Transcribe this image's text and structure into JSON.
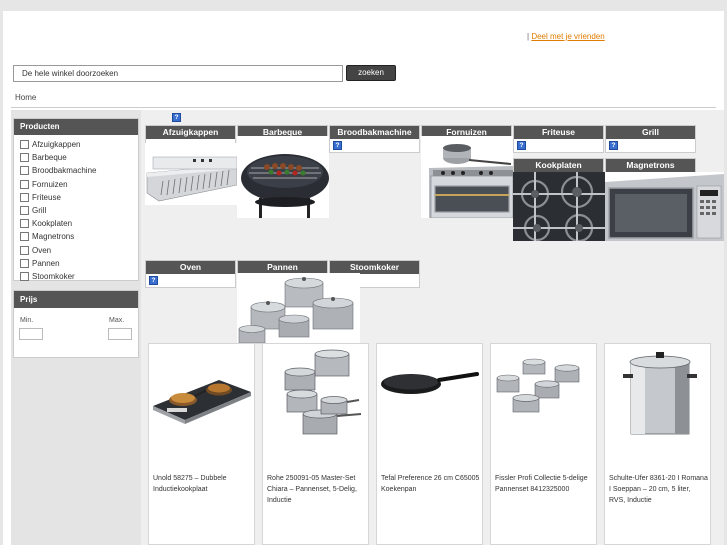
{
  "header": {
    "separator": "|",
    "share_link": "Deel met je vrienden"
  },
  "search": {
    "value": "De hele winkel doorzoeken",
    "button": "zoeken"
  },
  "breadcrumb": "Home",
  "sidebar": {
    "products_title": "Producten",
    "categories": [
      "Afzuigkappen",
      "Barbeque",
      "Broodbakmachine",
      "Fornuizen",
      "Friteuse",
      "Grill",
      "Kookplaten",
      "Magnetrons",
      "Oven",
      "Pannen",
      "Stoomkoker"
    ],
    "price_title": "Prijs",
    "price_min_label": "Min.",
    "price_max_label": "Max."
  },
  "category_tiles": {
    "afzuigkappen": "Afzuigkappen",
    "barbeque": "Barbeque",
    "broodbakmachine": "Broodbakmachine",
    "fornuizen": "Fornuizen",
    "friteuse": "Friteuse",
    "grill": "Grill",
    "kookplaten": "Kookplaten",
    "magnetrons": "Magnetrons",
    "oven": "Oven",
    "pannen": "Pannen",
    "stoomkoker": "Stoomkoker"
  },
  "help_icon_glyph": "?",
  "products": [
    {
      "name": "Unold 58275 – Dubbele Inductiekookplaat",
      "icon": "induction-cooktop-image"
    },
    {
      "name": "Rohe 250091-05 Master-Set Chiara – Pannenset, 5-Delig, Inductie",
      "icon": "pot-set-image"
    },
    {
      "name": "Tefal Preference 26 cm C65005 Koekenpan",
      "icon": "frying-pan-image"
    },
    {
      "name": "Fissler Profi Collectie 5-delige Pannenset 8412325000",
      "icon": "pan-set-image"
    },
    {
      "name": "Schulte-Ufer 8361-20 I Romana I Soeppan – 20 cm, 5 liter, RVS, Inductie",
      "icon": "stock-pot-image"
    }
  ]
}
